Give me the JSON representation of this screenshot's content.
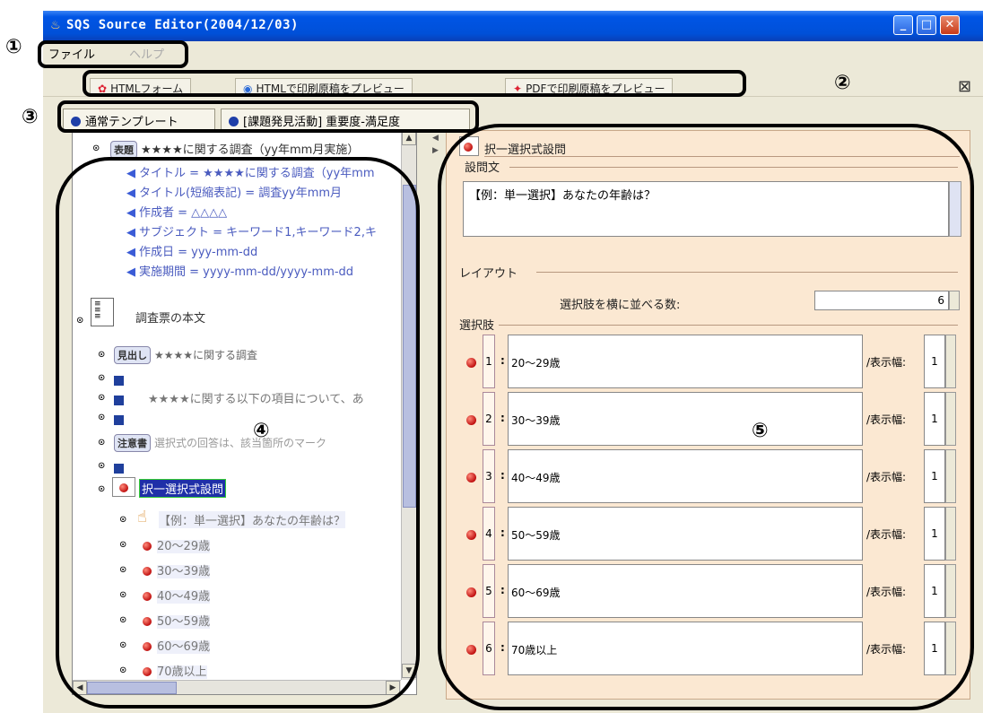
{
  "window": {
    "title": "SQS Source Editor(2004/12/03)",
    "min_glyph": "_",
    "max_glyph": "□",
    "close_glyph": "✕"
  },
  "menu": {
    "file": "ファイル",
    "help": "ヘルプ"
  },
  "toolbar": {
    "html_form": "HTMLフォーム",
    "html_preview": "HTMLで印刷原稿をプレビュー",
    "pdf_preview": "PDFで印刷原稿をプレビュー",
    "close_glyph": "⊠"
  },
  "tabs": [
    "通常テンプレート",
    "[課題発見活動] 重要度-満足度"
  ],
  "annotations": [
    "①",
    "②",
    "③",
    "④",
    "⑤"
  ],
  "tree": {
    "title_badge": "表題",
    "title_text": "★★★★に関する調査（yy年mm月実施）",
    "props": [
      "タイトル = ★★★★に関する調査（yy年mm",
      "タイトル(短縮表記) = 調査yy年mm月",
      "作成者 = △△△△",
      "サブジェクト = キーワード1,キーワード2,キ",
      "作成日 = yyy-mm-dd",
      "実施期間 = yyyy-mm-dd/yyyy-mm-dd"
    ],
    "body_label": "調査票の本文",
    "heading_badge": "見出し",
    "heading_text": "★★★★に関する調査",
    "paragraph_text": "★★★★に関する以下の項目について、あ",
    "note_badge": "注意書",
    "note_text": "選択式の回答は、該当箇所のマーク",
    "question_label": "択一選択式設問",
    "question_text": "【例：単一選択】あなたの年齢は？",
    "choices": [
      "20〜29歳",
      "30〜39歳",
      "40〜49歳",
      "50〜59歳",
      "60〜69歳",
      "70歳以上"
    ]
  },
  "editor": {
    "header": "択一選択式設問",
    "question_section": "設問文",
    "question_value": "【例：単一選択】あなたの年齢は？",
    "layout_section": "レイアウト",
    "layout_label": "選択肢を横に並べる数:",
    "layout_value": "6",
    "choices_section": "選択肢",
    "width_label": "/表示幅:",
    "choices": [
      {
        "num": "1",
        "text": "20〜29歳",
        "width": "1"
      },
      {
        "num": "2",
        "text": "30〜39歳",
        "width": "1"
      },
      {
        "num": "3",
        "text": "40〜49歳",
        "width": "1"
      },
      {
        "num": "4",
        "text": "50〜59歳",
        "width": "1"
      },
      {
        "num": "5",
        "text": "60〜69歳",
        "width": "1"
      },
      {
        "num": "6",
        "text": "70歳以上",
        "width": "1"
      }
    ]
  }
}
